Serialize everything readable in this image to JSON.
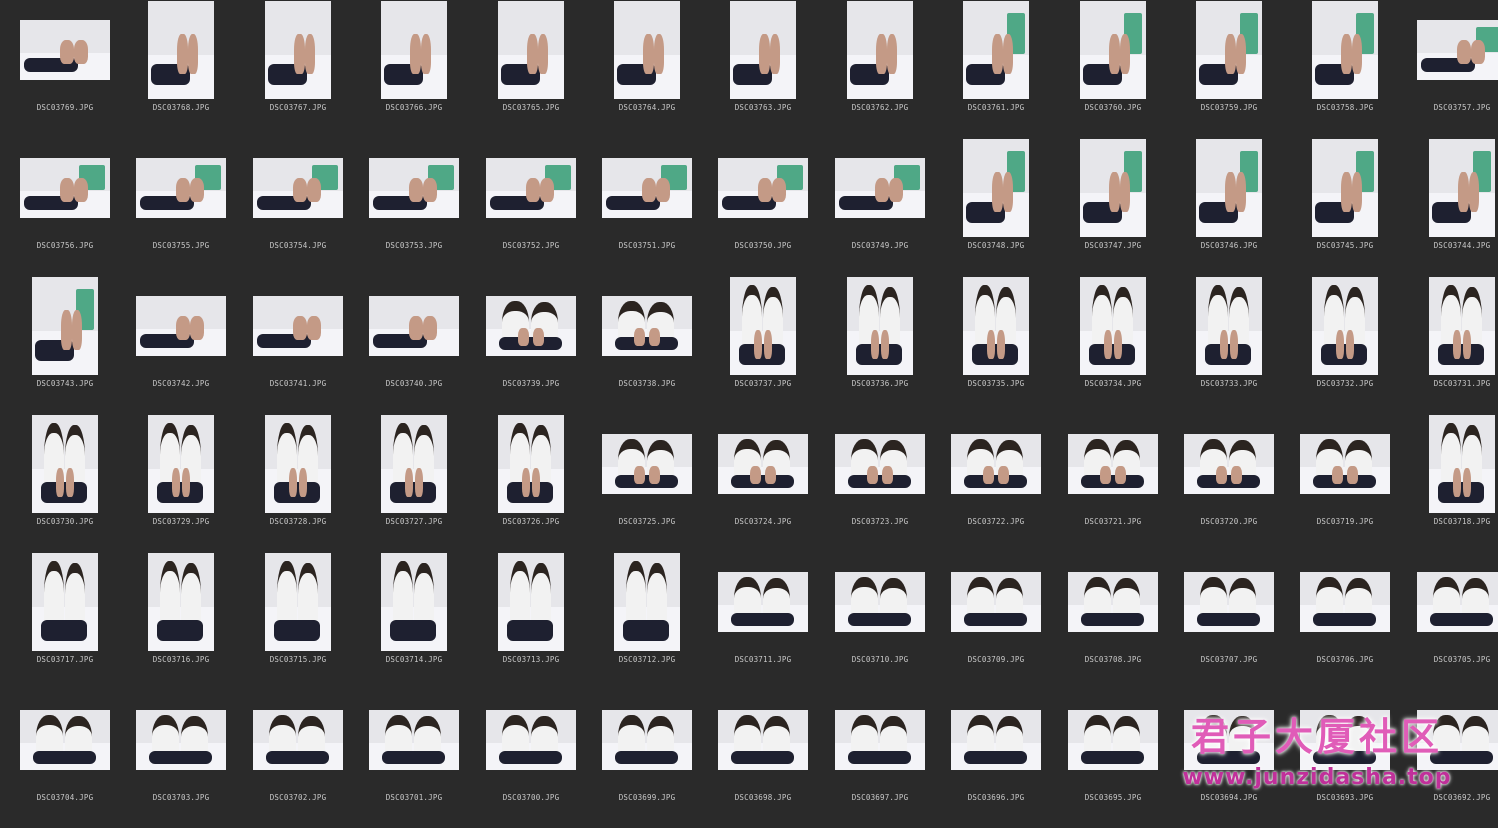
{
  "gallery": {
    "items": [
      {
        "filename": "DSC03769.JPG",
        "orientation": "landscape",
        "scene": "bed-close"
      },
      {
        "filename": "DSC03768.JPG",
        "orientation": "portrait",
        "scene": "feet-close"
      },
      {
        "filename": "DSC03767.JPG",
        "orientation": "portrait",
        "scene": "feet-close"
      },
      {
        "filename": "DSC03766.JPG",
        "orientation": "portrait",
        "scene": "feet-close"
      },
      {
        "filename": "DSC03765.JPG",
        "orientation": "portrait",
        "scene": "feet-close"
      },
      {
        "filename": "DSC03764.JPG",
        "orientation": "portrait",
        "scene": "feet-close"
      },
      {
        "filename": "DSC03763.JPG",
        "orientation": "portrait",
        "scene": "feet-close"
      },
      {
        "filename": "DSC03762.JPG",
        "orientation": "portrait",
        "scene": "feet-close"
      },
      {
        "filename": "DSC03761.JPG",
        "orientation": "portrait",
        "scene": "feet-chair"
      },
      {
        "filename": "DSC03760.JPG",
        "orientation": "portrait",
        "scene": "feet-chair"
      },
      {
        "filename": "DSC03759.JPG",
        "orientation": "portrait",
        "scene": "feet-chair"
      },
      {
        "filename": "DSC03758.JPG",
        "orientation": "portrait",
        "scene": "feet-chair"
      },
      {
        "filename": "DSC03757.JPG",
        "orientation": "landscape",
        "scene": "feet-chair"
      },
      {
        "filename": "DSC03756.JPG",
        "orientation": "landscape",
        "scene": "feet-chair"
      },
      {
        "filename": "DSC03755.JPG",
        "orientation": "landscape",
        "scene": "feet-chair"
      },
      {
        "filename": "DSC03754.JPG",
        "orientation": "landscape",
        "scene": "feet-chair"
      },
      {
        "filename": "DSC03753.JPG",
        "orientation": "landscape",
        "scene": "feet-chair"
      },
      {
        "filename": "DSC03752.JPG",
        "orientation": "landscape",
        "scene": "feet-chair"
      },
      {
        "filename": "DSC03751.JPG",
        "orientation": "landscape",
        "scene": "feet-chair"
      },
      {
        "filename": "DSC03750.JPG",
        "orientation": "landscape",
        "scene": "feet-chair"
      },
      {
        "filename": "DSC03749.JPG",
        "orientation": "landscape",
        "scene": "feet-chair"
      },
      {
        "filename": "DSC03748.JPG",
        "orientation": "portrait",
        "scene": "feet-chair"
      },
      {
        "filename": "DSC03747.JPG",
        "orientation": "portrait",
        "scene": "feet-chair"
      },
      {
        "filename": "DSC03746.JPG",
        "orientation": "portrait",
        "scene": "feet-chair"
      },
      {
        "filename": "DSC03745.JPG",
        "orientation": "portrait",
        "scene": "feet-chair"
      },
      {
        "filename": "DSC03744.JPG",
        "orientation": "portrait",
        "scene": "feet-chair"
      },
      {
        "filename": "DSC03743.JPG",
        "orientation": "portrait",
        "scene": "feet-chair"
      },
      {
        "filename": "DSC03742.JPG",
        "orientation": "landscape",
        "scene": "legs-wall"
      },
      {
        "filename": "DSC03741.JPG",
        "orientation": "landscape",
        "scene": "legs-wall"
      },
      {
        "filename": "DSC03740.JPG",
        "orientation": "landscape",
        "scene": "legs-wall"
      },
      {
        "filename": "DSC03739.JPG",
        "orientation": "landscape",
        "scene": "two-sitting"
      },
      {
        "filename": "DSC03738.JPG",
        "orientation": "landscape",
        "scene": "two-sitting"
      },
      {
        "filename": "DSC03737.JPG",
        "orientation": "portrait",
        "scene": "two-sitting"
      },
      {
        "filename": "DSC03736.JPG",
        "orientation": "portrait",
        "scene": "two-sitting"
      },
      {
        "filename": "DSC03735.JPG",
        "orientation": "portrait",
        "scene": "two-sitting"
      },
      {
        "filename": "DSC03734.JPG",
        "orientation": "portrait",
        "scene": "two-sitting"
      },
      {
        "filename": "DSC03733.JPG",
        "orientation": "portrait",
        "scene": "two-sitting"
      },
      {
        "filename": "DSC03732.JPG",
        "orientation": "portrait",
        "scene": "two-sitting"
      },
      {
        "filename": "DSC03731.JPG",
        "orientation": "portrait",
        "scene": "two-sitting"
      },
      {
        "filename": "DSC03730.JPG",
        "orientation": "portrait",
        "scene": "two-sitting"
      },
      {
        "filename": "DSC03729.JPG",
        "orientation": "portrait",
        "scene": "two-sitting"
      },
      {
        "filename": "DSC03728.JPG",
        "orientation": "portrait",
        "scene": "two-sitting"
      },
      {
        "filename": "DSC03727.JPG",
        "orientation": "portrait",
        "scene": "two-sitting"
      },
      {
        "filename": "DSC03726.JPG",
        "orientation": "portrait",
        "scene": "two-sitting"
      },
      {
        "filename": "DSC03725.JPG",
        "orientation": "landscape",
        "scene": "two-sitting"
      },
      {
        "filename": "DSC03724.JPG",
        "orientation": "landscape",
        "scene": "two-sitting"
      },
      {
        "filename": "DSC03723.JPG",
        "orientation": "landscape",
        "scene": "two-sitting"
      },
      {
        "filename": "DSC03722.JPG",
        "orientation": "landscape",
        "scene": "two-sitting"
      },
      {
        "filename": "DSC03721.JPG",
        "orientation": "landscape",
        "scene": "two-sitting"
      },
      {
        "filename": "DSC03720.JPG",
        "orientation": "landscape",
        "scene": "two-sitting"
      },
      {
        "filename": "DSC03719.JPG",
        "orientation": "landscape",
        "scene": "two-sitting"
      },
      {
        "filename": "DSC03718.JPG",
        "orientation": "portrait",
        "scene": "two-sitting"
      },
      {
        "filename": "DSC03717.JPG",
        "orientation": "portrait",
        "scene": "two-lounging"
      },
      {
        "filename": "DSC03716.JPG",
        "orientation": "portrait",
        "scene": "two-lounging"
      },
      {
        "filename": "DSC03715.JPG",
        "orientation": "portrait",
        "scene": "two-lounging"
      },
      {
        "filename": "DSC03714.JPG",
        "orientation": "portrait",
        "scene": "two-lounging"
      },
      {
        "filename": "DSC03713.JPG",
        "orientation": "portrait",
        "scene": "two-lounging"
      },
      {
        "filename": "DSC03712.JPG",
        "orientation": "portrait",
        "scene": "two-lounging"
      },
      {
        "filename": "DSC03711.JPG",
        "orientation": "landscape",
        "scene": "two-bent"
      },
      {
        "filename": "DSC03710.JPG",
        "orientation": "landscape",
        "scene": "two-bent"
      },
      {
        "filename": "DSC03709.JPG",
        "orientation": "landscape",
        "scene": "two-bent"
      },
      {
        "filename": "DSC03708.JPG",
        "orientation": "landscape",
        "scene": "two-bent"
      },
      {
        "filename": "DSC03707.JPG",
        "orientation": "landscape",
        "scene": "two-bent"
      },
      {
        "filename": "DSC03706.JPG",
        "orientation": "landscape",
        "scene": "two-bent"
      },
      {
        "filename": "DSC03705.JPG",
        "orientation": "landscape",
        "scene": "two-bent"
      },
      {
        "filename": "DSC03704.JPG",
        "orientation": "landscape",
        "scene": "two-bent"
      },
      {
        "filename": "DSC03703.JPG",
        "orientation": "landscape",
        "scene": "two-bent"
      },
      {
        "filename": "DSC03702.JPG",
        "orientation": "landscape",
        "scene": "two-bent"
      },
      {
        "filename": "DSC03701.JPG",
        "orientation": "landscape",
        "scene": "two-bent"
      },
      {
        "filename": "DSC03700.JPG",
        "orientation": "landscape",
        "scene": "two-bent"
      },
      {
        "filename": "DSC03699.JPG",
        "orientation": "landscape",
        "scene": "two-bent"
      },
      {
        "filename": "DSC03698.JPG",
        "orientation": "landscape",
        "scene": "two-bent"
      },
      {
        "filename": "DSC03697.JPG",
        "orientation": "landscape",
        "scene": "two-bent"
      },
      {
        "filename": "DSC03696.JPG",
        "orientation": "landscape",
        "scene": "two-bent"
      },
      {
        "filename": "DSC03695.JPG",
        "orientation": "landscape",
        "scene": "two-bent"
      },
      {
        "filename": "DSC03694.JPG",
        "orientation": "landscape",
        "scene": "two-bent"
      },
      {
        "filename": "DSC03693.JPG",
        "orientation": "landscape",
        "scene": "two-bent"
      },
      {
        "filename": "DSC03692.JPG",
        "orientation": "landscape",
        "scene": "two-bent"
      }
    ]
  },
  "watermark": {
    "title": "君子大厦社区",
    "url": "www.junzidasha.top"
  },
  "colors": {
    "background": "#2a2a2a",
    "caption": "#c8c8c8",
    "wall": "#e6e6ea",
    "bed": "#f4f4f8",
    "chair": "#4fa886",
    "dark_clothing": "#1e2030",
    "white_clothing": "#f2f2f2",
    "skin": "#c49a86",
    "hair": "#2b2420",
    "watermark_pink": "#e05cb8"
  }
}
